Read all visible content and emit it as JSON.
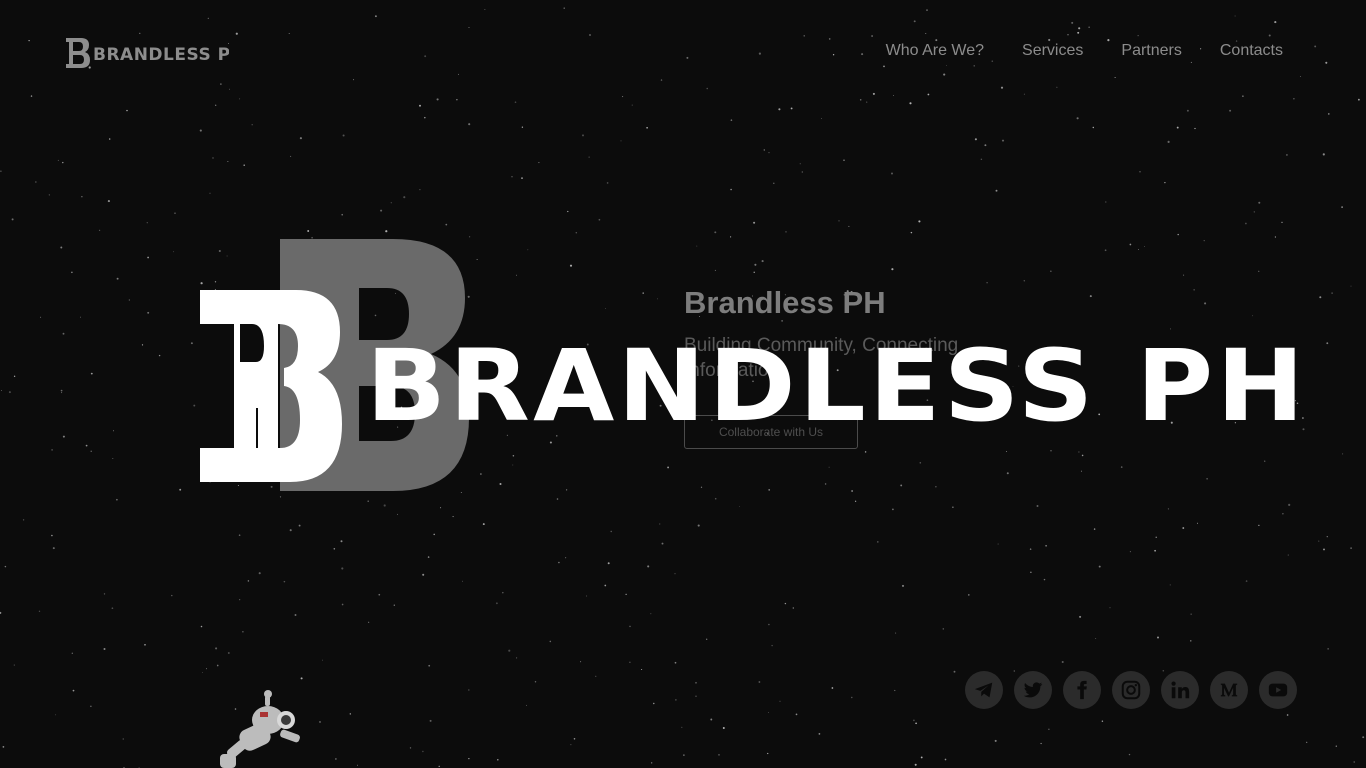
{
  "brand": {
    "logo_text": "BRANDLESS PH",
    "splash_text": "BRANDLESS PH"
  },
  "nav": {
    "items": [
      {
        "label": "Who Are We?"
      },
      {
        "label": "Services"
      },
      {
        "label": "Partners"
      },
      {
        "label": "Contacts"
      }
    ]
  },
  "hero": {
    "title": "Brandless PH",
    "tagline": "Building Community, Connecting Information",
    "cta_label": "Collaborate with Us"
  },
  "socials": [
    {
      "icon": "telegram-icon"
    },
    {
      "icon": "twitter-icon"
    },
    {
      "icon": "facebook-icon"
    },
    {
      "icon": "instagram-icon"
    },
    {
      "icon": "linkedin-icon"
    },
    {
      "icon": "medium-icon"
    },
    {
      "icon": "youtube-icon"
    }
  ],
  "colors": {
    "background": "#0c0c0c",
    "splash_text": "#ffffff",
    "nav_text": "#8c8c8c",
    "social_bg": "#2b2b2b"
  }
}
